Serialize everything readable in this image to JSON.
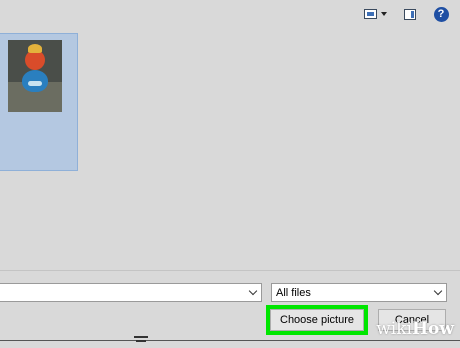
{
  "toolbar": {
    "view_icon": "change-view-icon",
    "preview_icon": "preview-pane-icon",
    "help_icon": "help-icon",
    "help_glyph": "?"
  },
  "files": [
    {
      "type": "image",
      "selected": true,
      "subject": "toy figurine photo"
    }
  ],
  "filename": {
    "value": ""
  },
  "file_filter": {
    "selected": "All files"
  },
  "actions": {
    "choose_label": "Choose picture",
    "cancel_label": "Cancel",
    "highlight_color": "#00e600"
  },
  "watermark": {
    "wiki": "wiki",
    "how": "How"
  }
}
